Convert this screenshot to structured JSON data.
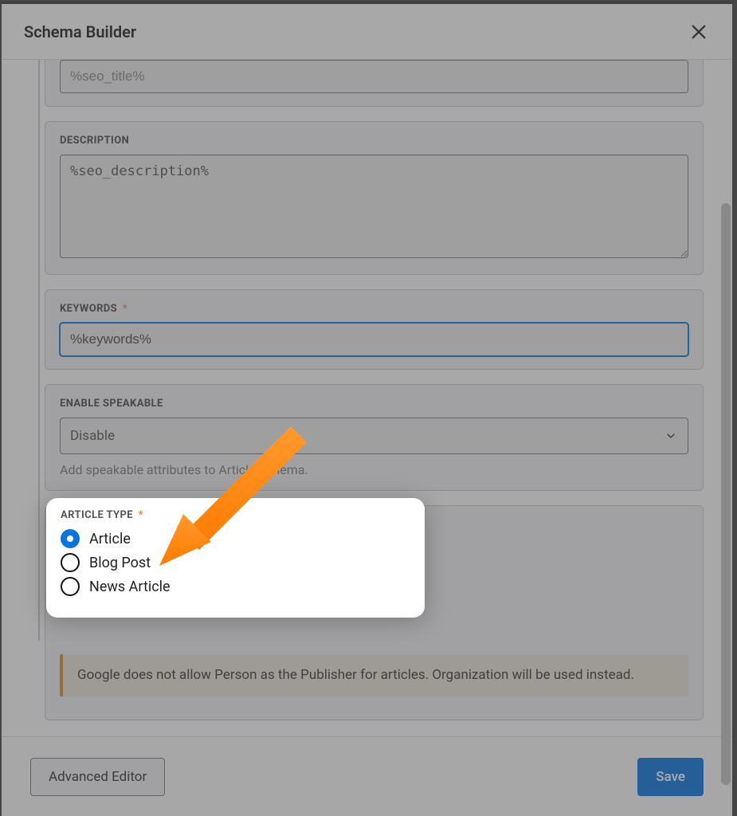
{
  "header": {
    "title": "Schema Builder"
  },
  "fields": {
    "seo_title": {
      "value": "%seo_title%"
    },
    "description": {
      "label": "DESCRIPTION",
      "value": "%seo_description%"
    },
    "keywords": {
      "label": "KEYWORDS",
      "required_mark": "*",
      "value": "%keywords%"
    },
    "speakable": {
      "label": "ENABLE SPEAKABLE",
      "selected": "Disable",
      "hint": "Add speakable attributes to Article Schema."
    },
    "article_type": {
      "label": "ARTICLE TYPE",
      "required_mark": "*",
      "options": [
        {
          "label": "Article",
          "checked": true
        },
        {
          "label": "Blog Post",
          "checked": false
        },
        {
          "label": "News Article",
          "checked": false
        }
      ]
    }
  },
  "notice": {
    "text": "Google does not allow Person as the Publisher for articles. Organization will be used instead."
  },
  "footer": {
    "advanced": "Advanced Editor",
    "save": "Save"
  }
}
